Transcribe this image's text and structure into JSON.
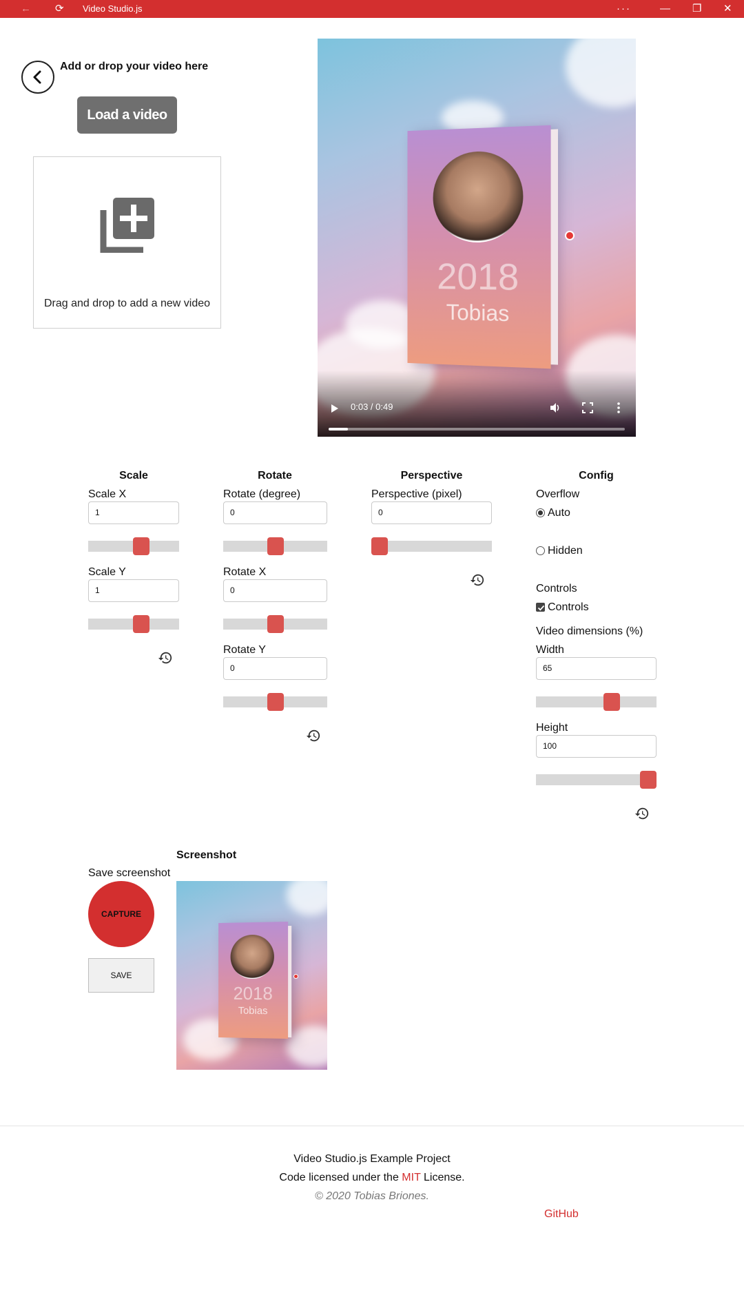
{
  "window": {
    "title": "Video Studio.js",
    "title_color": "#d32f2f",
    "buttons": {
      "back": "←",
      "refresh": "⟳",
      "more": "···",
      "minimize": "—",
      "maximize": "❐",
      "close": "✕"
    }
  },
  "upload": {
    "title": "Add or drop your video here",
    "load_button": "Load a video",
    "drop_text": "Drag and drop to add a new video",
    "drop_icon": "add-to-library-icon"
  },
  "video": {
    "time": "0:03 / 0:49",
    "progress_fraction": 0.065,
    "book_year": "2018",
    "book_name": "Tobias"
  },
  "scale": {
    "title": "Scale",
    "x": {
      "label": "Scale X",
      "value": "1",
      "slider_fraction": 0.58
    },
    "y": {
      "label": "Scale Y",
      "value": "1",
      "slider_fraction": 0.58
    }
  },
  "rotate": {
    "title": "Rotate",
    "degree": {
      "label": "Rotate (degree)",
      "value": "0",
      "slider_fraction": 0.5
    },
    "x": {
      "label": "Rotate X",
      "value": "0",
      "slider_fraction": 0.5
    },
    "y": {
      "label": "Rotate Y",
      "value": "0",
      "slider_fraction": 0.5
    }
  },
  "perspective": {
    "title": "Perspective",
    "pixel": {
      "label": "Perspective (pixel)",
      "value": "0",
      "slider_fraction": 0.0
    }
  },
  "config": {
    "title": "Config",
    "overflow_label": "Overflow",
    "overflow_auto": "Auto",
    "overflow_hidden": "Hidden",
    "overflow_selected": "Auto",
    "controls_label": "Controls",
    "controls_checkbox": "Controls",
    "controls_checked": true,
    "dimensions_label": "Video dimensions (%)",
    "width": {
      "label": "Width",
      "value": "65",
      "slider_fraction": 0.63
    },
    "height": {
      "label": "Height",
      "value": "100",
      "slider_fraction": 1.0
    }
  },
  "screenshot": {
    "title": "Screenshot",
    "save_label": "Save screenshot",
    "capture_button": "CAPTURE",
    "save_button": "SAVE"
  },
  "footer": {
    "line1": "Video Studio.js Example Project",
    "line2_prefix": "Code licensed under the ",
    "line2_link": "MIT",
    "line2_suffix": " License.",
    "copyright": "© 2020 Tobias Briones.",
    "github": "GitHub"
  },
  "colors": {
    "accent": "#d32f2f",
    "slider_thumb": "#d9534f",
    "slider_track": "#d8d8d8",
    "load_button_bg": "#6f6f6f"
  }
}
